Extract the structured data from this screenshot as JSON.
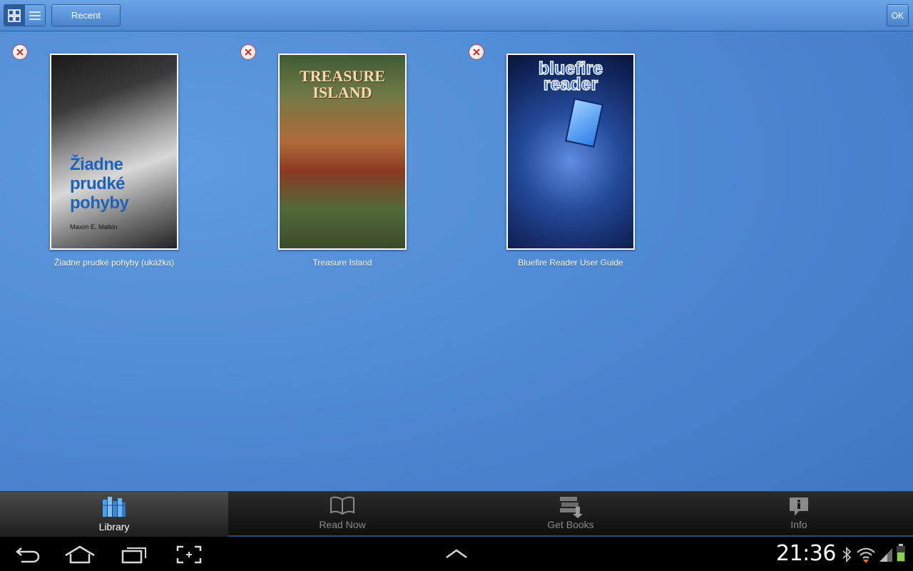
{
  "toolbar": {
    "recent_label": "Recent",
    "ok_label": "OK",
    "view_modes": [
      "grid-view-icon",
      "list-view-icon"
    ]
  },
  "books": [
    {
      "title": "Žiadne prudké pohyby (ukážka)",
      "cover_title": "Žiadne prudké pohyby",
      "cover_title_lines": [
        "Žiadne",
        "prudké",
        "pohyby"
      ],
      "cover_author": "Maxim E. Matkin"
    },
    {
      "title": "Treasure Island",
      "cover_title_lines": [
        "TREASURE",
        "ISLAND"
      ]
    },
    {
      "title": "Bluefire Reader User Guide",
      "cover_title_lines": [
        "bluefire",
        "reader"
      ]
    }
  ],
  "tabs": [
    {
      "label": "Library",
      "icon": "library-icon",
      "active": true
    },
    {
      "label": "Read Now",
      "icon": "open-book-icon",
      "active": false
    },
    {
      "label": "Get Books",
      "icon": "download-books-icon",
      "active": false
    },
    {
      "label": "Info",
      "icon": "info-icon",
      "active": false
    }
  ],
  "system_bar": {
    "time": "21:36",
    "icons": [
      "back-icon",
      "home-icon",
      "recent-apps-icon",
      "screenshot-icon",
      "expand-up-icon",
      "bluetooth-icon",
      "wifi-icon",
      "signal-icon",
      "battery-icon"
    ]
  },
  "colors": {
    "background": "#4f8ad5",
    "toolbar": "#5b94d8",
    "tabbar": "#1a1a1a",
    "active_tab_text": "#ffffff",
    "inactive_tab_text": "#8a8a8a",
    "remove_badge": "#c0392b"
  }
}
